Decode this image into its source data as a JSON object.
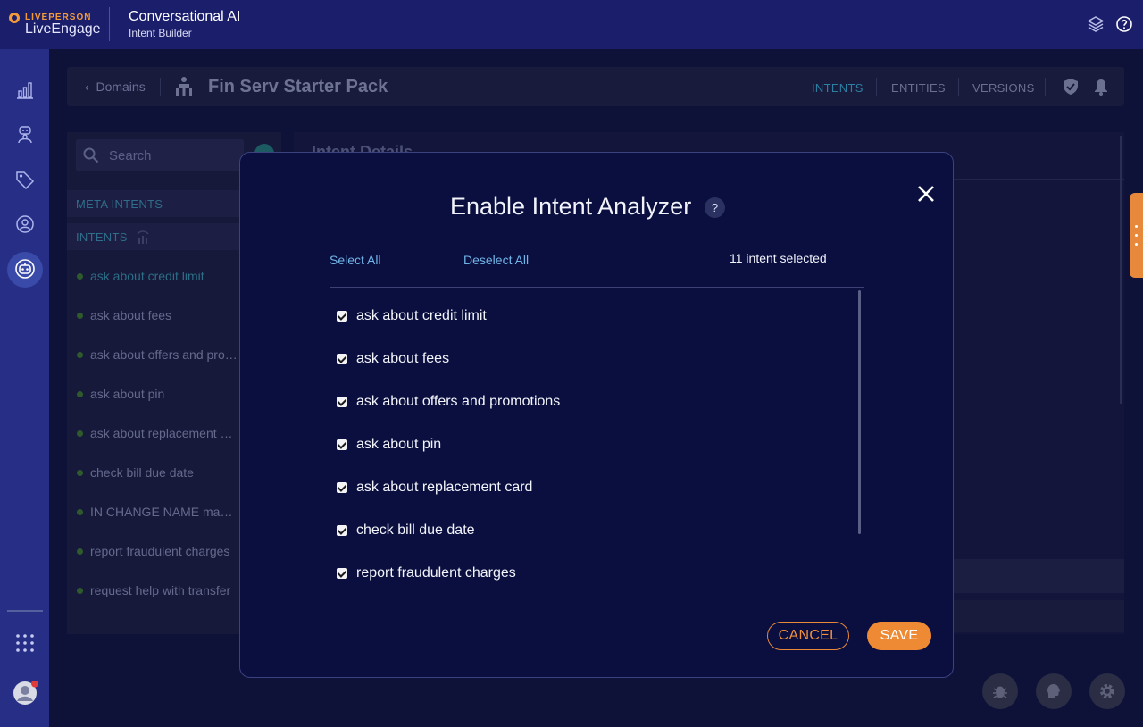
{
  "topbar": {
    "brand_small": "LIVEPERSON",
    "brand_big": "LiveEngage",
    "app_title": "Conversational AI",
    "app_subtitle": "Intent Builder",
    "icons": [
      "layers-icon",
      "help-circle-icon"
    ]
  },
  "leftnav": {
    "icons": [
      "analytics-icon",
      "agent-bot-icon",
      "tag-icon",
      "user-circle-icon",
      "ai-bot-icon",
      "apps-grid-icon",
      "user-avatar-icon"
    ]
  },
  "header": {
    "back_label": "Domains",
    "domain_title": "Fin Serv Starter Pack",
    "tabs": [
      "INTENTS",
      "ENTITIES",
      "VERSIONS"
    ],
    "active_tab": "INTENTS"
  },
  "left_panel": {
    "search_placeholder": "Search",
    "meta_intents_label": "META INTENTS",
    "intents_label": "INTENTS",
    "items": [
      "ask about credit limit",
      "ask about fees",
      "ask about offers and pro…",
      "ask about pin",
      "ask about replacement c…",
      "check bill due date",
      "IN CHANGE NAME make …",
      "report fraudulent charges",
      "request help with transfer"
    ]
  },
  "right_panel": {
    "title": "Intent Details"
  },
  "modal": {
    "title": "Enable Intent Analyzer",
    "help_label": "?",
    "select_all": "Select All",
    "deselect_all": "Deselect All",
    "selected_count": "11 intent selected",
    "items": [
      {
        "label": "ask about credit limit",
        "checked": true
      },
      {
        "label": "ask about fees",
        "checked": true
      },
      {
        "label": "ask about offers and promotions",
        "checked": true
      },
      {
        "label": "ask about pin",
        "checked": true
      },
      {
        "label": "ask about replacement card",
        "checked": true
      },
      {
        "label": "check bill due date",
        "checked": true
      },
      {
        "label": "report fraudulent charges",
        "checked": true
      }
    ],
    "cancel_label": "CANCEL",
    "save_label": "SAVE"
  },
  "colors": {
    "topbar_bg": "#1b1f6b",
    "nav_bg": "#262f85",
    "modal_bg": "#0a0f3f",
    "accent_orange": "#ee8a34",
    "link_blue": "#72b5e8"
  }
}
